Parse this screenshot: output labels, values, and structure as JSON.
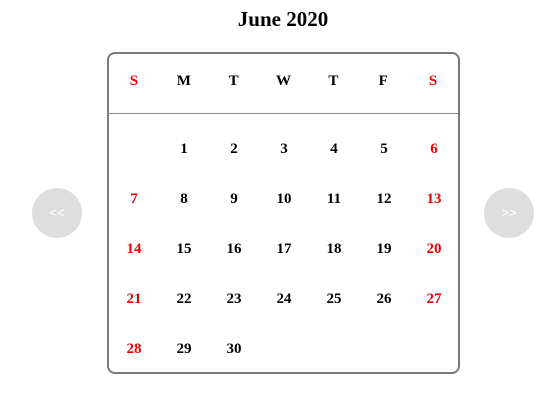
{
  "calendar": {
    "month_title": "June 2020",
    "weekdays": [
      {
        "label": "S",
        "weekend": true
      },
      {
        "label": "M",
        "weekend": false
      },
      {
        "label": "T",
        "weekend": false
      },
      {
        "label": "W",
        "weekend": false
      },
      {
        "label": "T",
        "weekend": false
      },
      {
        "label": "F",
        "weekend": false
      },
      {
        "label": "S",
        "weekend": true
      }
    ],
    "first_weekday_index": 1,
    "days": [
      "1",
      "2",
      "3",
      "4",
      "5",
      "6",
      "7",
      "8",
      "9",
      "10",
      "11",
      "12",
      "13",
      "14",
      "15",
      "16",
      "17",
      "18",
      "19",
      "20",
      "21",
      "22",
      "23",
      "24",
      "25",
      "26",
      "27",
      "28",
      "29",
      "30"
    ],
    "colors": {
      "weekend": "#ee0000",
      "weekday": "#000000",
      "nav_button_bg": "#dedede",
      "border": "#7a7a7a"
    }
  },
  "navigation": {
    "prev_label": "<<",
    "next_label": ">>"
  }
}
